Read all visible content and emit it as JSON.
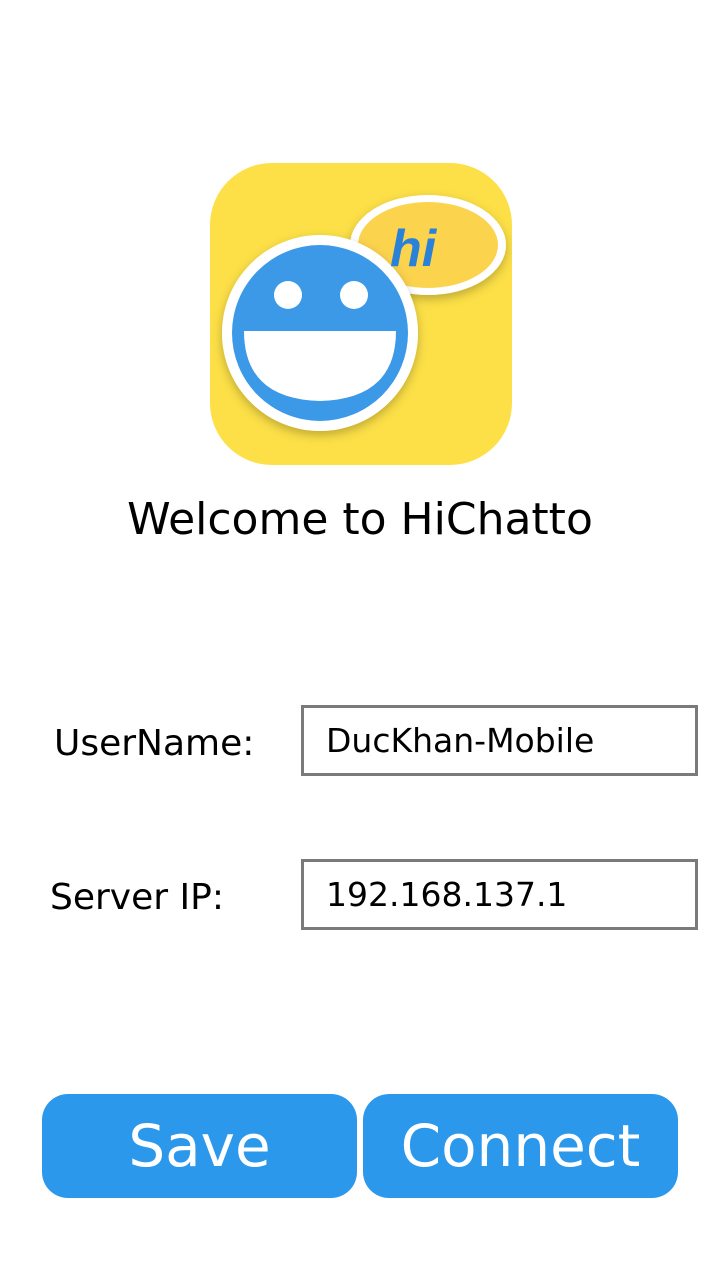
{
  "app": {
    "logo_text": "hi",
    "welcome_text": "Welcome to HiChatto"
  },
  "form": {
    "username_label": "UserName:",
    "username_value": "DucKhan-Mobile",
    "server_label": "Server IP:",
    "server_value": "192.168.137.1"
  },
  "buttons": {
    "save_label": "Save",
    "connect_label": "Connect"
  },
  "colors": {
    "button_blue": "#2c98ec",
    "logo_yellow": "#fde047",
    "face_blue": "#3b99e8",
    "input_border": "#7a7a7a"
  }
}
